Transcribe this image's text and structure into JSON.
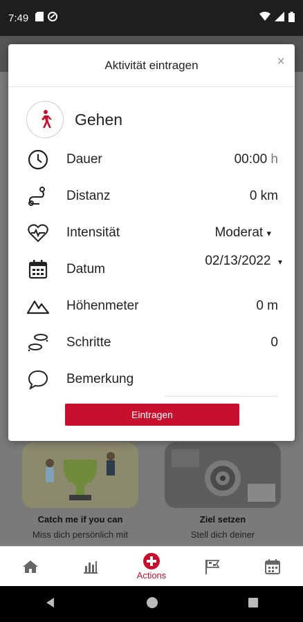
{
  "status_bar": {
    "time": "7:49"
  },
  "modal": {
    "title": "Aktivität eintragen",
    "close_label": "×",
    "activity": {
      "name": "Gehen"
    },
    "fields": {
      "duration": {
        "label": "Dauer",
        "value": "00:00",
        "unit": "h"
      },
      "distance": {
        "label": "Distanz",
        "value": "0 km"
      },
      "intensity": {
        "label": "Intensität",
        "value": "Moderat",
        "caret": "▾"
      },
      "date": {
        "label": "Datum",
        "value": "02/13/2022",
        "caret": "▾"
      },
      "elevation": {
        "label": "Höhenmeter",
        "value": "0 m"
      },
      "steps": {
        "label": "Schritte",
        "value": "0"
      },
      "remark": {
        "label": "Bemerkung",
        "value": ""
      }
    },
    "submit_label": "Eintragen"
  },
  "cards": [
    {
      "title": "Catch me if you can",
      "subtitle": "Miss dich persönlich mit"
    },
    {
      "title": "Ziel setzen",
      "subtitle": "Stell dich deiner"
    }
  ],
  "bottom_nav": {
    "items": [
      {
        "icon": "home-icon",
        "label": ""
      },
      {
        "icon": "chart-icon",
        "label": ""
      },
      {
        "icon": "plus-circle-icon",
        "label": "Actions"
      },
      {
        "icon": "flag-icon",
        "label": ""
      },
      {
        "icon": "calendar-icon",
        "label": ""
      }
    ]
  },
  "colors": {
    "accent": "#c8102e"
  }
}
